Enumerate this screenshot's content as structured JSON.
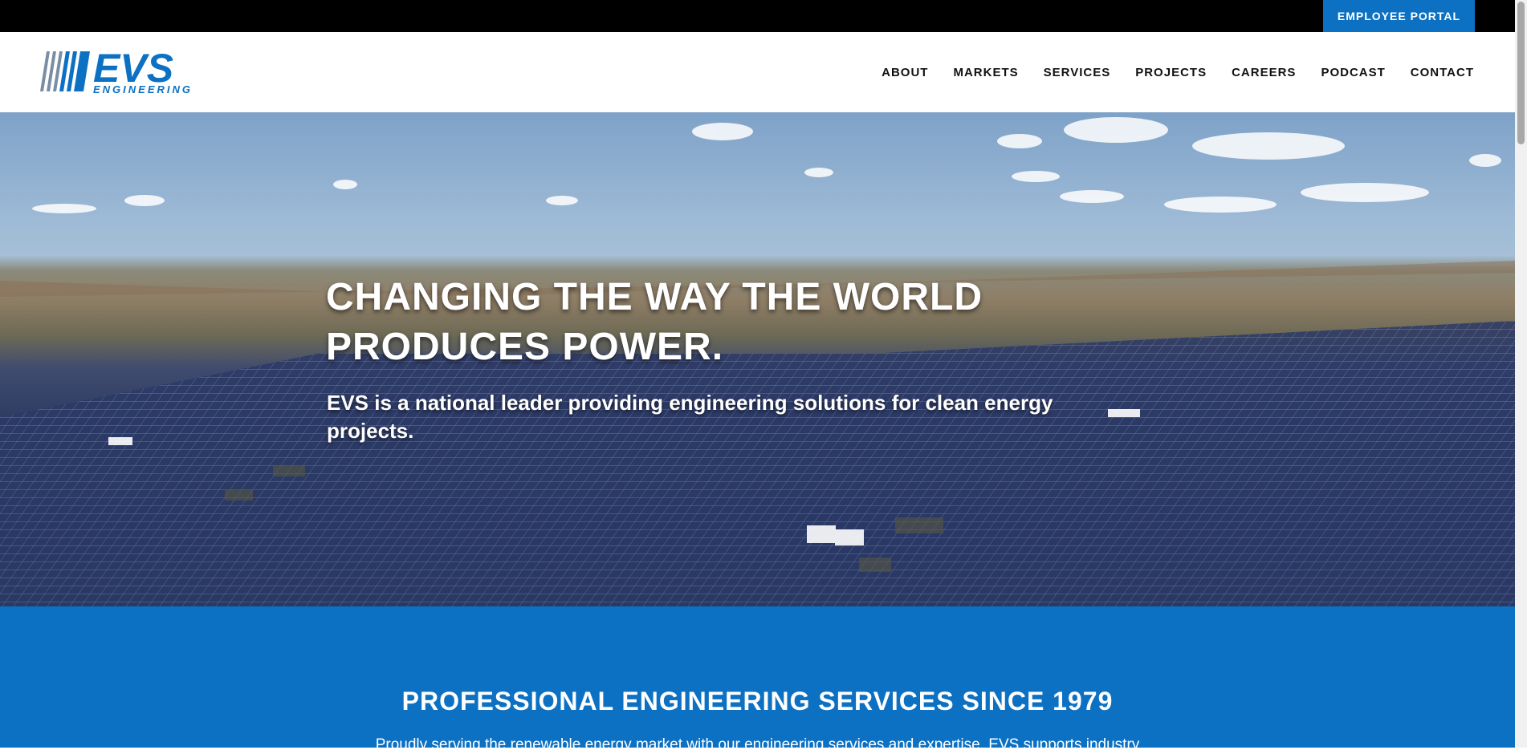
{
  "topbar": {
    "portal_label": "EMPLOYEE PORTAL"
  },
  "logo": {
    "brand": "EVS",
    "tagline": "ENGINEERING"
  },
  "nav": {
    "items": [
      {
        "label": "ABOUT"
      },
      {
        "label": "MARKETS"
      },
      {
        "label": "SERVICES"
      },
      {
        "label": "PROJECTS"
      },
      {
        "label": "CAREERS"
      },
      {
        "label": "PODCAST"
      },
      {
        "label": "CONTACT"
      }
    ]
  },
  "hero": {
    "title": "CHANGING THE WAY THE WORLD PRODUCES POWER.",
    "subtitle": "EVS is a national leader providing engineering solutions for clean energy projects."
  },
  "band": {
    "title": "PROFESSIONAL ENGINEERING SERVICES SINCE 1979",
    "text": "Proudly serving the renewable energy market with our engineering services and expertise. EVS supports industry"
  },
  "colors": {
    "accent": "#0c71c3",
    "topbar": "#000000"
  }
}
